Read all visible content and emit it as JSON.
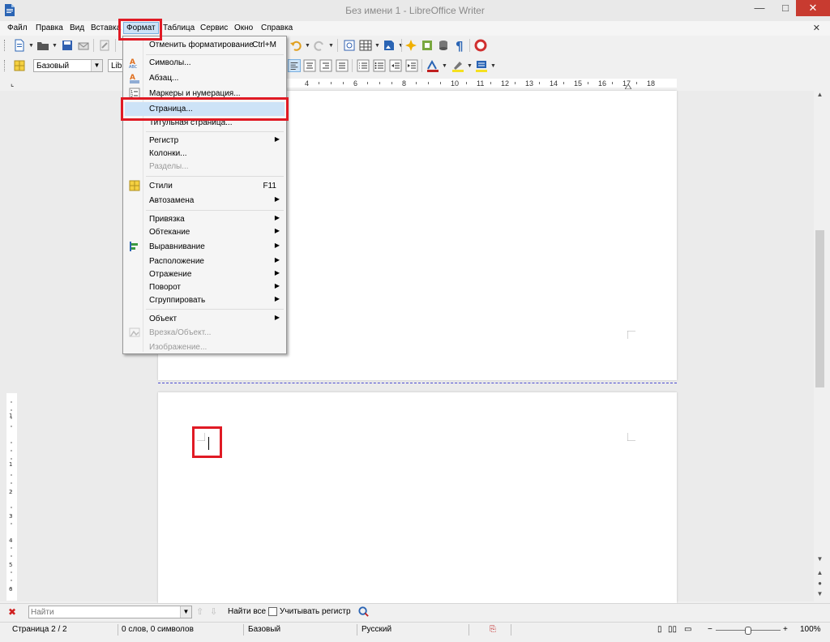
{
  "window": {
    "title": "Без имени 1 - LibreOffice Writer"
  },
  "menubar": {
    "items": [
      "Файл",
      "Правка",
      "Вид",
      "Вставка",
      "Формат",
      "Таблица",
      "Сервис",
      "Окно",
      "Справка"
    ],
    "close": "✕"
  },
  "toolbar2": {
    "style_value": "Базовый",
    "font_value": "Lib"
  },
  "ruler": {
    "numbers": [
      "4",
      "6",
      "8",
      "10",
      "11",
      "12",
      "13",
      "14",
      "15",
      "16",
      "17",
      "18"
    ]
  },
  "format_menu": {
    "items": [
      {
        "label": "Отменить форматирование",
        "shortcut": "Ctrl+M"
      },
      {
        "label": "Символы..."
      },
      {
        "label": "Абзац..."
      },
      {
        "label": "Маркеры и нумерация..."
      },
      {
        "label": "Страница..."
      },
      {
        "label": "Титульная страница..."
      },
      {
        "label": "Регистр"
      },
      {
        "label": "Колонки..."
      },
      {
        "label": "Разделы..."
      },
      {
        "label": "Стили",
        "shortcut": "F11"
      },
      {
        "label": "Автозамена"
      },
      {
        "label": "Привязка"
      },
      {
        "label": "Обтекание"
      },
      {
        "label": "Выравнивание"
      },
      {
        "label": "Расположение"
      },
      {
        "label": "Отражение"
      },
      {
        "label": "Поворот"
      },
      {
        "label": "Сгруппировать"
      },
      {
        "label": "Объект"
      },
      {
        "label": "Врезка/Объект..."
      },
      {
        "label": "Изображение..."
      }
    ]
  },
  "findbar": {
    "placeholder": "Найти",
    "find_all": "Найти все",
    "match_case": "Учитывать регистр"
  },
  "statusbar": {
    "page": "Страница 2 / 2",
    "words": "0 слов, 0 символов",
    "style": "Базовый",
    "language": "Русский",
    "zoom": "100%"
  },
  "colors": {
    "highlight": "#e01a24",
    "menu_hover": "#cde3f7",
    "close_button": "#c83b30"
  }
}
